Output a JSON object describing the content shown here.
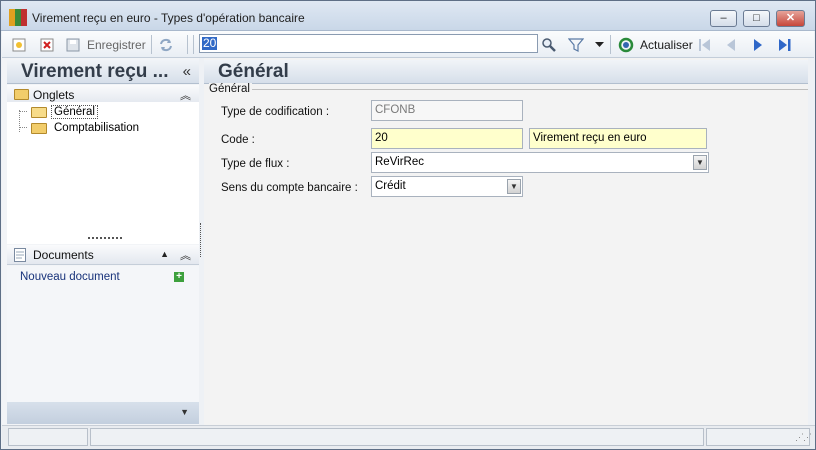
{
  "window": {
    "title": "Virement reçu en euro -  Types d'opération bancaire",
    "buttons": {
      "minimize": "–",
      "maximize": "□",
      "close": "✕"
    }
  },
  "toolbar": {
    "save_label": "Enregistrer",
    "search_value": "20",
    "refresh_label": "Actualiser"
  },
  "left_panel": {
    "title": "Virement reçu ...",
    "collapse_glyph": "«",
    "tabs_group": {
      "title": "Onglets",
      "items": [
        {
          "label": "Général",
          "selected": true
        },
        {
          "label": "Comptabilisation",
          "selected": false
        }
      ]
    },
    "documents_group": {
      "title": "Documents",
      "new_document": "Nouveau document"
    }
  },
  "main": {
    "title": "Général",
    "section_legend": "Général",
    "fields": {
      "codification_type": {
        "label": "Type de codification :",
        "value": "CFONB"
      },
      "code": {
        "label": "Code :",
        "value": "20",
        "description": "Virement reçu en euro"
      },
      "flow_type": {
        "label": "Type de flux :",
        "value": "ReVirRec"
      },
      "bank_account_direction": {
        "label": "Sens du compte bancaire :",
        "value": "Crédit"
      }
    }
  },
  "colors": {
    "titlebar": "#c9d7e8",
    "required_field": "#ffffcc",
    "link": "#17327a",
    "search_selection": "#3169c6"
  }
}
